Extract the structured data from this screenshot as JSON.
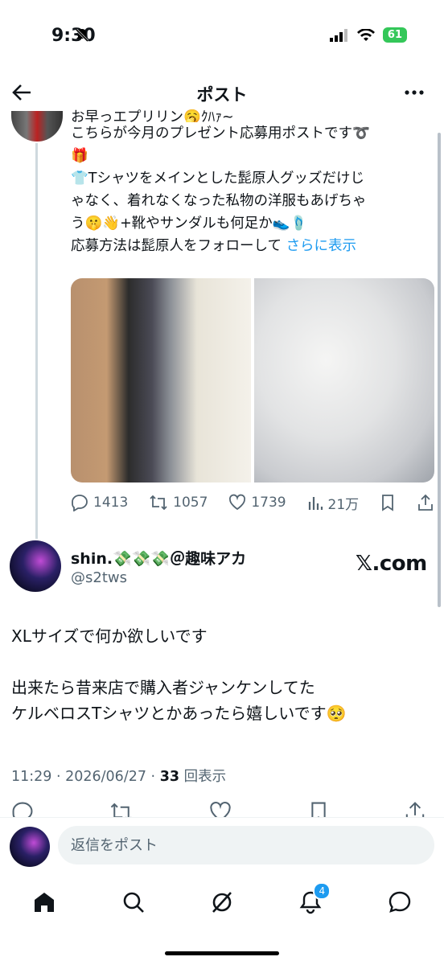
{
  "status": {
    "time": "9:30",
    "battery": "61"
  },
  "nav": {
    "title": "ポスト"
  },
  "quoted": {
    "lines": [
      "お早っエプリリン🥱ｸﾊｧ~",
      "こちらが今月のプレゼント応募用ポストです➰",
      "🎁",
      "👕Tシャツをメインとした髭原人グッズだけじ",
      "ゃなく、着れなくなった私物の洋服もあげちゃ",
      "う🤫👋+靴やサンダルも何足か👟🩴"
    ],
    "last_line": "応募方法は髭原人をフォローして",
    "more_link": "さらに表示",
    "replies": "1413",
    "reposts": "1057",
    "likes": "1739",
    "views": "21万"
  },
  "tweet": {
    "name": "shin.💸💸💸＠趣味アカ",
    "handle": "@s2tws",
    "xcom": "𝕏.com",
    "line1": "XLサイズで何か欲しいです",
    "line2": "出来たら昔来店で購入者ジャンケンしてた",
    "line3": "ケルベロスTシャツとかあったら嬉しいです🥺",
    "time": "11:29 · 2026/06/27 · ",
    "view_count": "33",
    "view_label": " 回表示"
  },
  "reply": {
    "placeholder": "返信をポスト"
  },
  "tabs": {
    "notif_badge": "4"
  }
}
